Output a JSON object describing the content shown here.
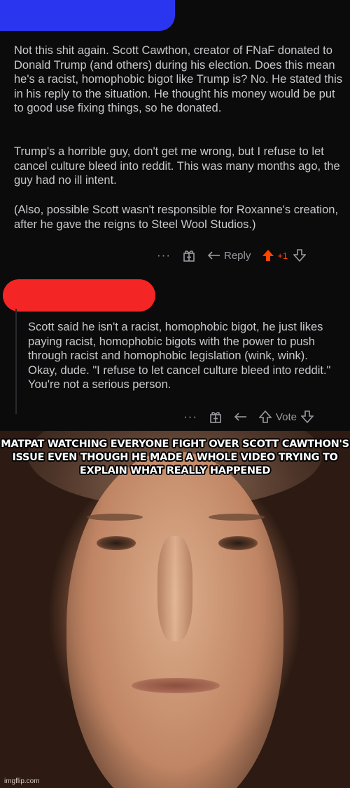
{
  "comment1": {
    "paragraphs": [
      "Not this shit again. Scott Cawthon, creator of FNaF donated to Donald Trump (and others) during his election. Does this mean he's a racist, homophobic bigot like Trump is? No. He stated this in his reply to the situation. He thought his money would be put to good use fixing things, so he donated.",
      "Trump's a horrible guy, don't get me wrong, but I refuse to let cancel culture bleed into reddit. This was many months ago, the guy had no ill intent.",
      "(Also, possible Scott wasn't responsible for Roxanne's creation, after he gave the reigns to Steel Wool Studios.)"
    ],
    "actions": {
      "more": "···",
      "reply": "Reply",
      "vote_count": "+1"
    }
  },
  "comment2": {
    "text": "Scott said he isn't a racist, homophobic bigot, he just likes paying racist, homophobic bigots with the power to push through racist and homophobic legislation (wink, wink). Okay, dude. \"I refuse to let cancel culture bleed into reddit.\" You're not a serious person.",
    "actions": {
      "more": "···",
      "vote": "Vote"
    }
  },
  "meme": {
    "caption": "MATPAT WATCHING EVERYONE FIGHT OVER SCOTT CAWTHON'S ISSUE EVEN THOUGH HE MADE A WHOLE VIDEO TRYING TO EXPLAIN WHAT REALLY HAPPENED",
    "watermark": "imgflip.com"
  },
  "colors": {
    "upvote_active": "#ff4500",
    "redaction_blue": "#2a35f0",
    "redaction_red": "#f42525"
  },
  "icons": [
    "more-icon",
    "award-icon",
    "reply-icon",
    "upvote-icon",
    "downvote-icon"
  ]
}
